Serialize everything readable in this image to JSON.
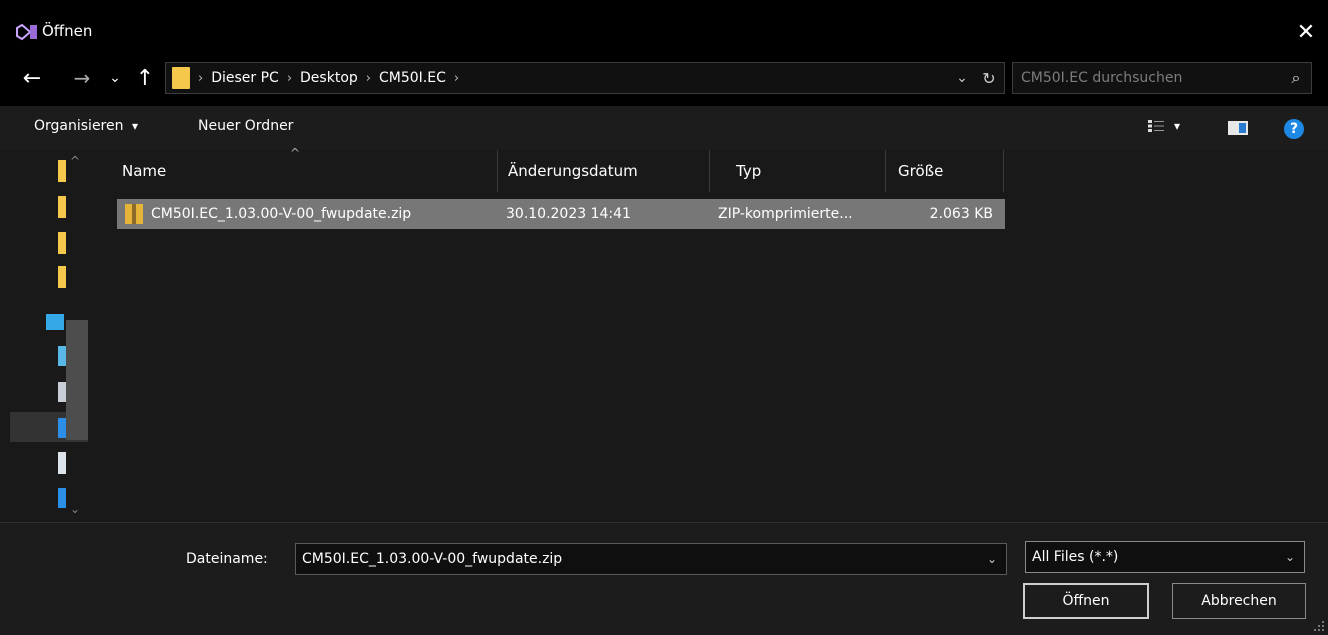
{
  "window": {
    "title": "Öffnen",
    "close_glyph": "✕",
    "app_icon": "visual-studio-icon"
  },
  "nav": {
    "back_glyph": "←",
    "forward_glyph": "→",
    "recent_glyph": "⌄",
    "up_glyph": "↑",
    "breadcrumbs": [
      "Dieser PC",
      "Desktop",
      "CM50I.EC"
    ],
    "dropdown_glyph": "⌄",
    "refresh_glyph": "↻",
    "search_placeholder": "CM50I.EC durchsuchen",
    "search_glyph": "⌕"
  },
  "toolbar": {
    "organize_label": "Organisieren",
    "organize_arrow": "▾",
    "new_folder_label": "Neuer Ordner",
    "view_arrow": "▾",
    "help_glyph": "?"
  },
  "columns": {
    "name": "Name",
    "date": "Änderungsdatum",
    "type": "Typ",
    "size": "Größe",
    "sort_glyph": "^"
  },
  "files": [
    {
      "name": "CM50I.EC_1.03.00-V-00_fwupdate.zip",
      "date": "30.10.2023 14:41",
      "type": "ZIP-komprimierte...",
      "size": "2.063 KB"
    }
  ],
  "footer": {
    "filename_label": "Dateiname:",
    "filename_value": "CM50I.EC_1.03.00-V-00_fwupdate.zip",
    "dropdown_glyph": "⌄",
    "filetype_value": "All Files (*.*)",
    "open_label": "Öffnen",
    "cancel_label": "Abbrechen"
  },
  "colors": {
    "background": "#1c1c1c",
    "titlebar": "#000000",
    "selection": "#777777",
    "folder": "#f5c84c",
    "help": "#1e88e5"
  }
}
